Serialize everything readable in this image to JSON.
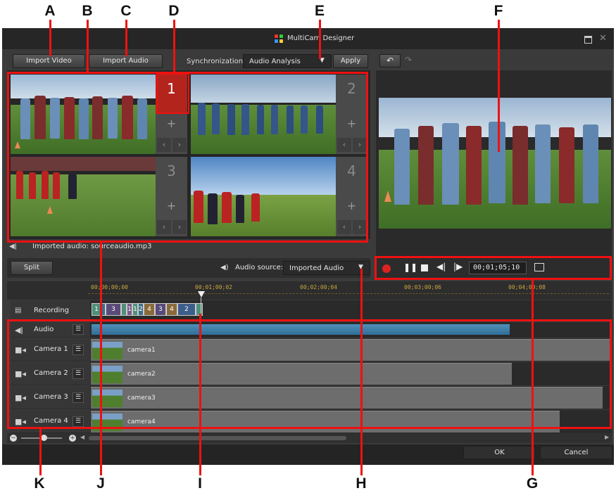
{
  "window": {
    "title": "MultiCam Designer"
  },
  "callouts": [
    "A",
    "B",
    "C",
    "D",
    "E",
    "F",
    "G",
    "H",
    "I",
    "J",
    "K"
  ],
  "toolbar": {
    "import_video": "Import Video",
    "import_audio": "Import Audio",
    "sync_label": "Synchronization:",
    "sync_value": "Audio Analysis",
    "apply": "Apply"
  },
  "cameras": [
    {
      "number": "1",
      "active": true
    },
    {
      "number": "2",
      "active": false
    },
    {
      "number": "3",
      "active": false
    },
    {
      "number": "4",
      "active": false
    }
  ],
  "audio_info": "Imported audio: sourceaudio.mp3",
  "controls": {
    "split": "Split",
    "audio_source_label": "Audio source:",
    "audio_source_value": "Imported Audio"
  },
  "preview": {
    "timecode": "00;01;05;10"
  },
  "ruler": [
    "00;00;00;00",
    "00;01;00;02",
    "00;02;00;04",
    "00;03;00;06",
    "00;04;00;08"
  ],
  "tracks": {
    "recording": "Recording",
    "recording_segments": [
      "1",
      "3",
      "1",
      "1",
      "2",
      "4",
      "3",
      "4",
      "2"
    ],
    "audio": "Audio",
    "cameras": [
      {
        "label": "Camera 1",
        "clip": "camera1"
      },
      {
        "label": "Camera 2",
        "clip": "camera2"
      },
      {
        "label": "Camera 3",
        "clip": "camera3"
      },
      {
        "label": "Camera 4",
        "clip": "camera4"
      }
    ]
  },
  "footer": {
    "ok": "OK",
    "cancel": "Cancel"
  },
  "colors": {
    "highlight": "#e11111",
    "active_camera": "#b3241c",
    "accent_gold": "#c9a640"
  }
}
